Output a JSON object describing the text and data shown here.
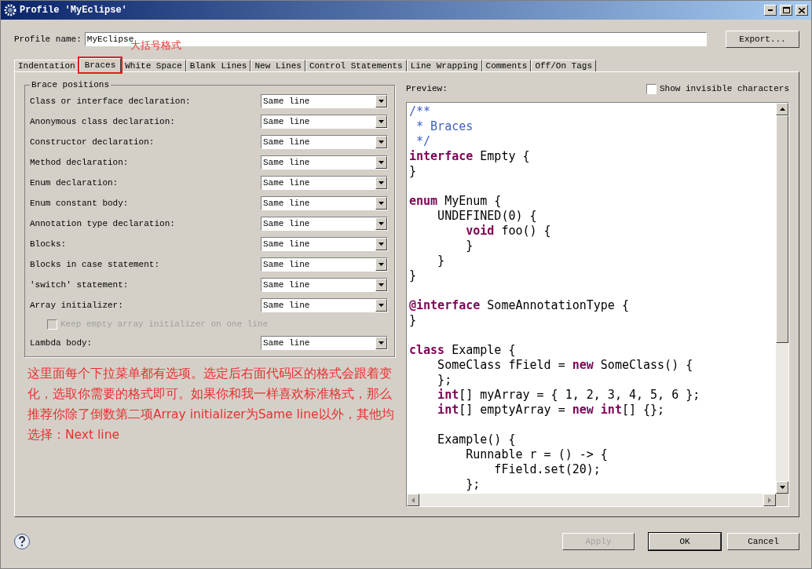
{
  "window": {
    "title": "Profile 'MyEclipse'"
  },
  "profile_name": {
    "label": "Profile name:",
    "value": "MyEclipse"
  },
  "export_button": "Export...",
  "tabs": [
    {
      "label": "Indentation",
      "selected": false,
      "annotated": false
    },
    {
      "label": "Braces",
      "selected": true,
      "annotated": true
    },
    {
      "label": "White Space",
      "selected": false,
      "annotated": false
    },
    {
      "label": "Blank Lines",
      "selected": false,
      "annotated": false
    },
    {
      "label": "New Lines",
      "selected": false,
      "annotated": false
    },
    {
      "label": "Control Statements",
      "selected": false,
      "annotated": false
    },
    {
      "label": "Line Wrapping",
      "selected": false,
      "annotated": false
    },
    {
      "label": "Comments",
      "selected": false,
      "annotated": false
    },
    {
      "label": "Off/On Tags",
      "selected": false,
      "annotated": false
    }
  ],
  "tab_annotation": "大括号格式",
  "brace_positions": {
    "title": "Brace positions",
    "rows": [
      {
        "kind": "select",
        "label": "Class or interface declaration:",
        "value": "Same line"
      },
      {
        "kind": "select",
        "label": "Anonymous class declaration:",
        "value": "Same line"
      },
      {
        "kind": "select",
        "label": "Constructor declaration:",
        "value": "Same line"
      },
      {
        "kind": "select",
        "label": "Method declaration:",
        "value": "Same line"
      },
      {
        "kind": "select",
        "label": "Enum declaration:",
        "value": "Same line"
      },
      {
        "kind": "select",
        "label": "Enum constant body:",
        "value": "Same line"
      },
      {
        "kind": "select",
        "label": "Annotation type declaration:",
        "value": "Same line"
      },
      {
        "kind": "select",
        "label": "Blocks:",
        "value": "Same line"
      },
      {
        "kind": "select",
        "label": "Blocks in case statement:",
        "value": "Same line"
      },
      {
        "kind": "select",
        "label": "'switch' statement:",
        "value": "Same line"
      },
      {
        "kind": "select",
        "label": "Array initializer:",
        "value": "Same line"
      },
      {
        "kind": "checkbox",
        "label": "Keep empty array initializer on one line",
        "checked": false,
        "disabled": true
      },
      {
        "kind": "select",
        "label": "Lambda body:",
        "value": "Same line"
      }
    ]
  },
  "note": "这里面每个下拉菜单都有选项。选定后右面代码区的格式会跟着变化，选取你需要的格式即可。如果你和我一样喜欢标准格式，那么推荐你除了倒数第二项Array initializer为Same line以外，其他均选择：Next line",
  "preview": {
    "label": "Preview:",
    "show_invisible": {
      "label": "Show invisible characters",
      "checked": false
    },
    "lines": [
      {
        "kind": "code",
        "tokens": [
          {
            "kind": "comment",
            "text": "/**"
          }
        ]
      },
      {
        "kind": "code",
        "tokens": [
          {
            "kind": "comment",
            "text": " * Braces"
          }
        ]
      },
      {
        "kind": "code",
        "tokens": [
          {
            "kind": "comment",
            "text": " */"
          }
        ]
      },
      {
        "kind": "code",
        "tokens": [
          {
            "kind": "keyword",
            "text": "interface"
          },
          {
            "kind": "plain",
            "text": " Empty {"
          }
        ]
      },
      {
        "kind": "code",
        "tokens": [
          {
            "kind": "plain",
            "text": "}"
          }
        ]
      },
      {
        "kind": "blank"
      },
      {
        "kind": "code",
        "tokens": [
          {
            "kind": "keyword",
            "text": "enum"
          },
          {
            "kind": "plain",
            "text": " MyEnum {"
          }
        ]
      },
      {
        "kind": "code",
        "tokens": [
          {
            "kind": "plain",
            "text": "    UNDEFINED(0) {"
          }
        ]
      },
      {
        "kind": "code",
        "tokens": [
          {
            "kind": "keyword",
            "text": "        void"
          },
          {
            "kind": "plain",
            "text": " foo() {"
          }
        ]
      },
      {
        "kind": "code",
        "tokens": [
          {
            "kind": "plain",
            "text": "        }"
          }
        ]
      },
      {
        "kind": "code",
        "tokens": [
          {
            "kind": "plain",
            "text": "    }"
          }
        ]
      },
      {
        "kind": "code",
        "tokens": [
          {
            "kind": "plain",
            "text": "}"
          }
        ]
      },
      {
        "kind": "blank"
      },
      {
        "kind": "code",
        "tokens": [
          {
            "kind": "keyword",
            "text": "@interface"
          },
          {
            "kind": "plain",
            "text": " SomeAnnotationType {"
          }
        ]
      },
      {
        "kind": "code",
        "tokens": [
          {
            "kind": "plain",
            "text": "}"
          }
        ]
      },
      {
        "kind": "blank"
      },
      {
        "kind": "code",
        "tokens": [
          {
            "kind": "keyword",
            "text": "class"
          },
          {
            "kind": "plain",
            "text": " Example {"
          }
        ]
      },
      {
        "kind": "code",
        "tokens": [
          {
            "kind": "plain",
            "text": "    SomeClass fField = "
          },
          {
            "kind": "keyword",
            "text": "new"
          },
          {
            "kind": "plain",
            "text": " SomeClass() {"
          }
        ]
      },
      {
        "kind": "code",
        "tokens": [
          {
            "kind": "plain",
            "text": "    };"
          }
        ]
      },
      {
        "kind": "code",
        "tokens": [
          {
            "kind": "keyword",
            "text": "    int"
          },
          {
            "kind": "plain",
            "text": "[] myArray = { 1, 2, 3, 4, 5, 6 };"
          }
        ]
      },
      {
        "kind": "code",
        "tokens": [
          {
            "kind": "keyword",
            "text": "    int"
          },
          {
            "kind": "plain",
            "text": "[] emptyArray = "
          },
          {
            "kind": "keyword",
            "text": "new int"
          },
          {
            "kind": "plain",
            "text": "[] {};"
          }
        ]
      },
      {
        "kind": "blank"
      },
      {
        "kind": "code",
        "tokens": [
          {
            "kind": "plain",
            "text": "    Example() {"
          }
        ]
      },
      {
        "kind": "code",
        "tokens": [
          {
            "kind": "plain",
            "text": "        Runnable r = () -> {"
          }
        ]
      },
      {
        "kind": "code",
        "tokens": [
          {
            "kind": "plain",
            "text": "            fField.set(20);"
          }
        ]
      },
      {
        "kind": "code",
        "tokens": [
          {
            "kind": "plain",
            "text": "        };"
          }
        ]
      }
    ]
  },
  "buttons": [
    {
      "label": "Apply",
      "disabled": true,
      "default": false
    },
    {
      "label": "OK",
      "disabled": false,
      "default": true
    },
    {
      "label": "Cancel",
      "disabled": false,
      "default": false
    }
  ]
}
